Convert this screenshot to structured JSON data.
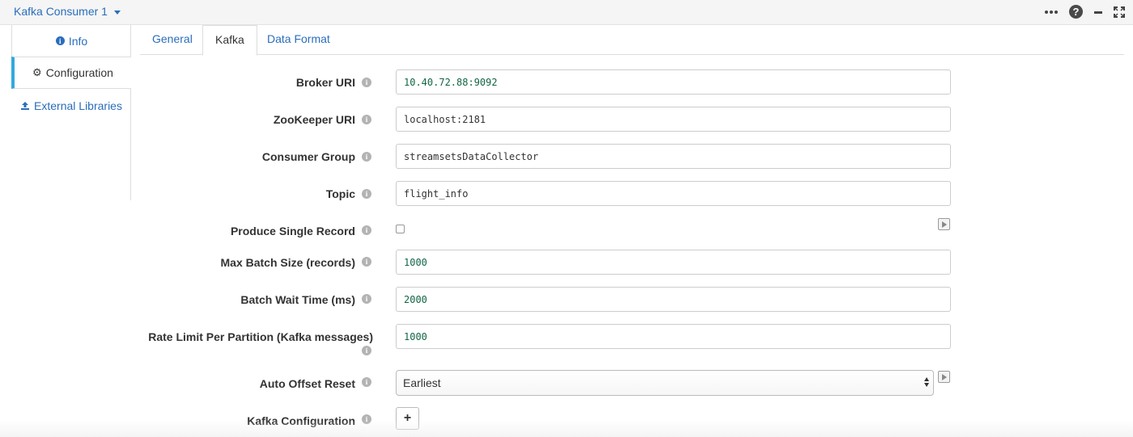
{
  "header": {
    "stage_title": "Kafka Consumer 1",
    "icons": [
      "more-dots-icon",
      "help-icon",
      "minimize-icon",
      "maximize-icon"
    ]
  },
  "leftnav": {
    "items": [
      {
        "label": "Info",
        "icon": "info-icon"
      },
      {
        "label": "Configuration",
        "icon": "gear-icon"
      },
      {
        "label": "External Libraries",
        "icon": "upload-icon"
      }
    ]
  },
  "tabs": [
    {
      "label": "General"
    },
    {
      "label": "Kafka"
    },
    {
      "label": "Data Format"
    }
  ],
  "form": {
    "broker_uri": {
      "label": "Broker URI",
      "value": "10.40.72.88:9092"
    },
    "zookeeper_uri": {
      "label": "ZooKeeper URI",
      "value": "localhost:2181"
    },
    "consumer_group": {
      "label": "Consumer Group",
      "value": "streamsetsDataCollector"
    },
    "topic": {
      "label": "Topic",
      "value": "flight_info"
    },
    "produce_single_record": {
      "label": "Produce Single Record",
      "checked": false
    },
    "max_batch_size": {
      "label": "Max Batch Size (records)",
      "value": "1000"
    },
    "batch_wait_time": {
      "label": "Batch Wait Time (ms)",
      "value": "2000"
    },
    "rate_limit": {
      "label": "Rate Limit Per Partition (Kafka messages)",
      "value": "1000"
    },
    "auto_offset_reset": {
      "label": "Auto Offset Reset",
      "value": "Earliest"
    },
    "kafka_configuration": {
      "label": "Kafka Configuration",
      "add_label": "+"
    }
  },
  "colors": {
    "link": "#2a6ebb",
    "active_nav_accent": "#31a9de",
    "number_text": "#116644"
  }
}
